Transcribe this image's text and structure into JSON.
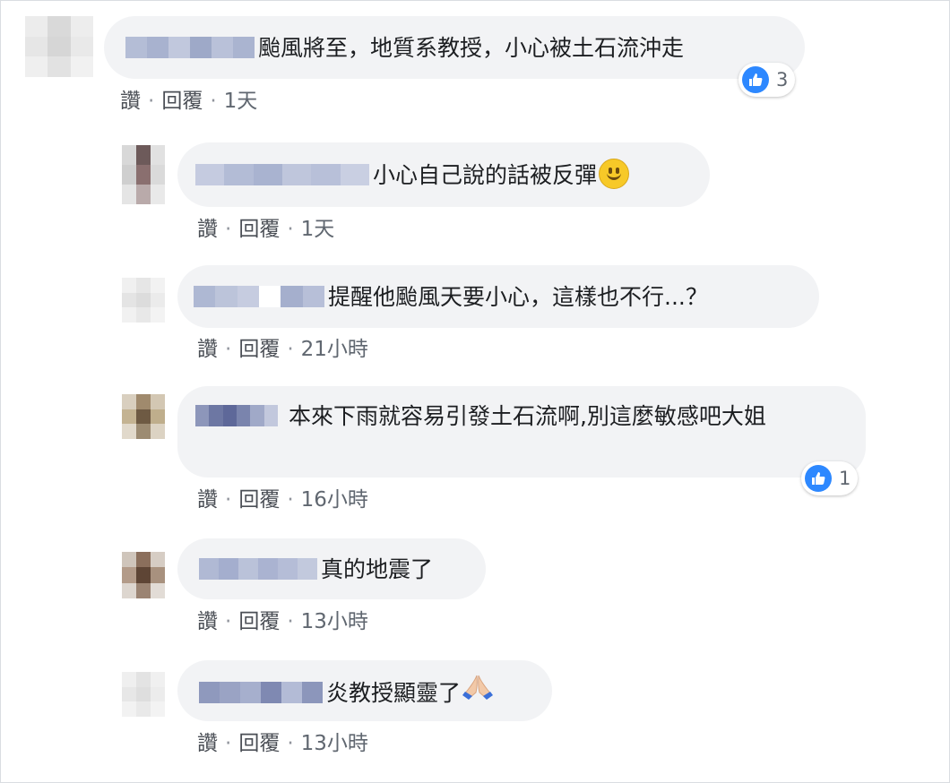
{
  "actions": {
    "like": "讚",
    "reply": "回覆"
  },
  "comments": [
    {
      "text": "颱風將至，地質系教授，小心被土石流沖走",
      "time": "1天",
      "reactions": "3",
      "avatar_colors": [
        "#ececec",
        "#d9d9d9",
        "#ededed",
        "#e6e6e6",
        "#d6d6d6",
        "#e9e9e9",
        "#efefef",
        "#e2e2e2",
        "#f1f1f1"
      ],
      "name_colors": [
        "#b4bdd6",
        "#a8b2cf",
        "#c1c8dd",
        "#9ea9c8",
        "#b9c1d9",
        "#aab4d0"
      ]
    },
    {
      "text": "小心自己說的話被反彈",
      "emoji": "smile-emoji",
      "time": "1天",
      "avatar_colors": [
        "#d8d8d8",
        "#6d5a5a",
        "#e1e1e1",
        "#cfcfcf",
        "#8a6f6f",
        "#dadada",
        "#e5e5e5",
        "#b9aaaa",
        "#e9e9e9"
      ],
      "name_colors": [
        "#c5cbe0",
        "#b3bcd6",
        "#a9b3d0",
        "#bfc6dc",
        "#b8c0d9",
        "#c9cfe2"
      ]
    },
    {
      "text": "提醒他颱風天要小心，這樣也不行...？",
      "time": "21小時",
      "avatar_colors": [
        "#f0f0f0",
        "#e6e6e6",
        "#f2f2f2",
        "#e4e4e4",
        "#dcdcdc",
        "#ebebeb",
        "#f1f1f1",
        "#e8e8e8",
        "#f3f3f3"
      ],
      "name_colors": [
        "#aeb8d3",
        "#bcc4da",
        "#c6cce0",
        "#ffffff",
        "#a5afcd",
        "#b7bfd8"
      ]
    },
    {
      "text": "本來下雨就容易引發土石流啊,別這麼敏感吧大姐",
      "time": "16小時",
      "reactions": "1",
      "avatar_colors": [
        "#d9cfbf",
        "#a08a6d",
        "#d3c7b3",
        "#c4b392",
        "#6e5a43",
        "#bfae8c",
        "#e1d9cb",
        "#9c8b72",
        "#dcd3c3"
      ],
      "name_colors": [
        "#8d96ba",
        "#6d77a3",
        "#5e6899",
        "#7a84ad",
        "#a0a9c8",
        "#c2c8dd"
      ]
    },
    {
      "text": "真的地震了",
      "time": "13小時",
      "avatar_colors": [
        "#cfc5bb",
        "#8b6f5c",
        "#d6cdc4",
        "#b39b89",
        "#5e4535",
        "#a8917e",
        "#ddd6cf",
        "#9b8473",
        "#e2dcd6"
      ],
      "name_colors": [
        "#b0b9d4",
        "#a4aece",
        "#bac2d9",
        "#aab3d1",
        "#b5bdd7",
        "#c2c9dd"
      ]
    },
    {
      "text": "炎教授顯靈了",
      "emoji": "folded-hands-emoji",
      "time": "13小時",
      "avatar_colors": [
        "#efefef",
        "#e3e3e3",
        "#f0f0f0",
        "#e7e7e7",
        "#dedede",
        "#ececec",
        "#f2f2f2",
        "#e9e9e9",
        "#f3f3f3"
      ],
      "name_colors": [
        "#8f99bd",
        "#9aa3c4",
        "#a6afcd",
        "#7f89b2",
        "#b3bbd6",
        "#8c96bb"
      ]
    }
  ]
}
